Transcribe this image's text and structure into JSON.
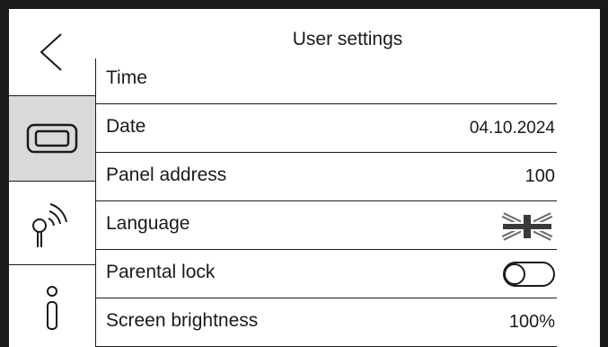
{
  "header": {
    "title": "User settings"
  },
  "rail": {
    "back": "back-chevron-icon",
    "items": [
      {
        "icon": "display-icon",
        "active": true
      },
      {
        "icon": "wireless-signal-icon",
        "active": false
      },
      {
        "icon": "info-icon",
        "active": false
      }
    ]
  },
  "settings": [
    {
      "label": "Time",
      "value": ""
    },
    {
      "label": "Date",
      "value": "04.10.2024"
    },
    {
      "label": "Panel address",
      "value": "100"
    },
    {
      "label": "Language",
      "value_icon": "uk-flag-icon"
    },
    {
      "label": "Parental lock",
      "toggle_on": false
    },
    {
      "label": "Screen brightness",
      "value": "100%"
    }
  ],
  "colors": {
    "background": "#ffffff",
    "frame": "#1a1a1a",
    "active_rail": "#d9d9d9"
  }
}
